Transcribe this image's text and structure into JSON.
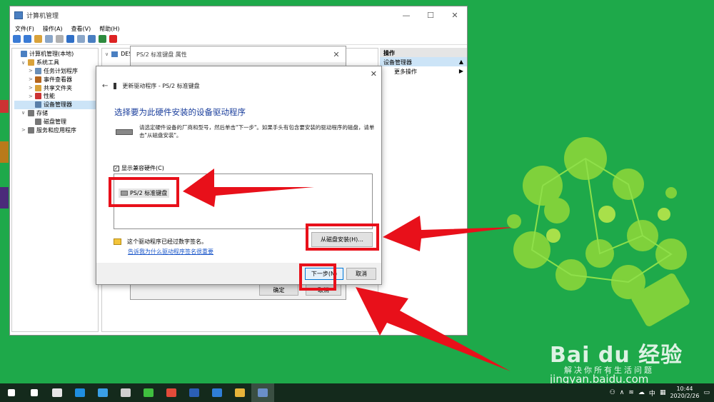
{
  "window": {
    "title": "计算机管理",
    "menu": [
      "文件(F)",
      "操作(A)",
      "查看(V)",
      "帮助(H)"
    ],
    "controls": [
      "—",
      "☐",
      "✕"
    ]
  },
  "tree": {
    "items": [
      {
        "label": "计算机管理(本地)",
        "indent": 0,
        "arrow": "",
        "color": "#4a7fc1"
      },
      {
        "label": "系统工具",
        "indent": 1,
        "arrow": "∨",
        "color": "#d9a23a"
      },
      {
        "label": "任务计划程序",
        "indent": 2,
        "arrow": ">",
        "color": "#6a8fb8"
      },
      {
        "label": "事件查看器",
        "indent": 2,
        "arrow": ">",
        "color": "#b5651d"
      },
      {
        "label": "共享文件夹",
        "indent": 2,
        "arrow": ">",
        "color": "#d9a23a"
      },
      {
        "label": "性能",
        "indent": 2,
        "arrow": ">",
        "color": "#cc3333"
      },
      {
        "label": "设备管理器",
        "indent": 2,
        "arrow": "",
        "color": "#5a7fa8",
        "selected": true
      },
      {
        "label": "存储",
        "indent": 1,
        "arrow": "∨",
        "color": "#777777"
      },
      {
        "label": "磁盘管理",
        "indent": 2,
        "arrow": "",
        "color": "#777777"
      },
      {
        "label": "服务和应用程序",
        "indent": 1,
        "arrow": ">",
        "color": "#777777"
      }
    ]
  },
  "center": {
    "root_label": "DES"
  },
  "actions": {
    "title": "操作",
    "selected": "设备管理器",
    "more": "更多操作"
  },
  "properties": {
    "title": "PS/2 标准键盘 属性",
    "ok": "确定",
    "cancel": "取消"
  },
  "wizard": {
    "header": "更新驱动程序 - PS/2 标准键盘",
    "heading": "选择要为此硬件安装的设备驱动程序",
    "description": "请选定硬件设备的厂商和型号，然后单击\"下一步\"。如果手头有包含要安装的驱动程序的磁盘，请单击\"从磁盘安装\"。",
    "show_compatible": "显示兼容硬件(C)",
    "model": "PS/2 标准键盘",
    "signed_text": "这个驱动程序已经过数字签名。",
    "why_link": "告诉我为什么驱动程序签名很重要",
    "have_disk": "从磁盘安装(H)...",
    "next": "下一步(N)",
    "cancel": "取消",
    "close": "✕"
  },
  "watermark": {
    "brand": "Bai du 经验",
    "slogan": "解决你所有生活问题",
    "url": "jingyan.baidu.com"
  },
  "taskbar": {
    "icons": [
      {
        "name": "windows-start-icon",
        "color": "#ffffff"
      },
      {
        "name": "search-icon",
        "color": "#ffffff"
      },
      {
        "name": "petal-app-icon",
        "color": "#e6e6e6"
      },
      {
        "name": "browser-icon",
        "color": "#1f8fe0"
      },
      {
        "name": "ie-icon",
        "color": "#3aa0e6"
      },
      {
        "name": "app-box-icon",
        "color": "#cfcfcf"
      },
      {
        "name": "wechat-icon",
        "color": "#3fbf3f"
      },
      {
        "name": "wps-icon",
        "color": "#e24b3a"
      },
      {
        "name": "word-icon",
        "color": "#2b5fb5"
      },
      {
        "name": "mail-icon",
        "color": "#2f7fd8"
      },
      {
        "name": "folder-icon",
        "color": "#e6b43a"
      },
      {
        "name": "computer-management-icon",
        "color": "#6a8fc8"
      }
    ],
    "ime": "中",
    "time": "10:44",
    "date": "2020/2/26"
  },
  "colors": {
    "desktop": "#1ea94a",
    "highlight": "#e8101a",
    "heading": "#1a3e9c",
    "link": "#1a56c9"
  }
}
